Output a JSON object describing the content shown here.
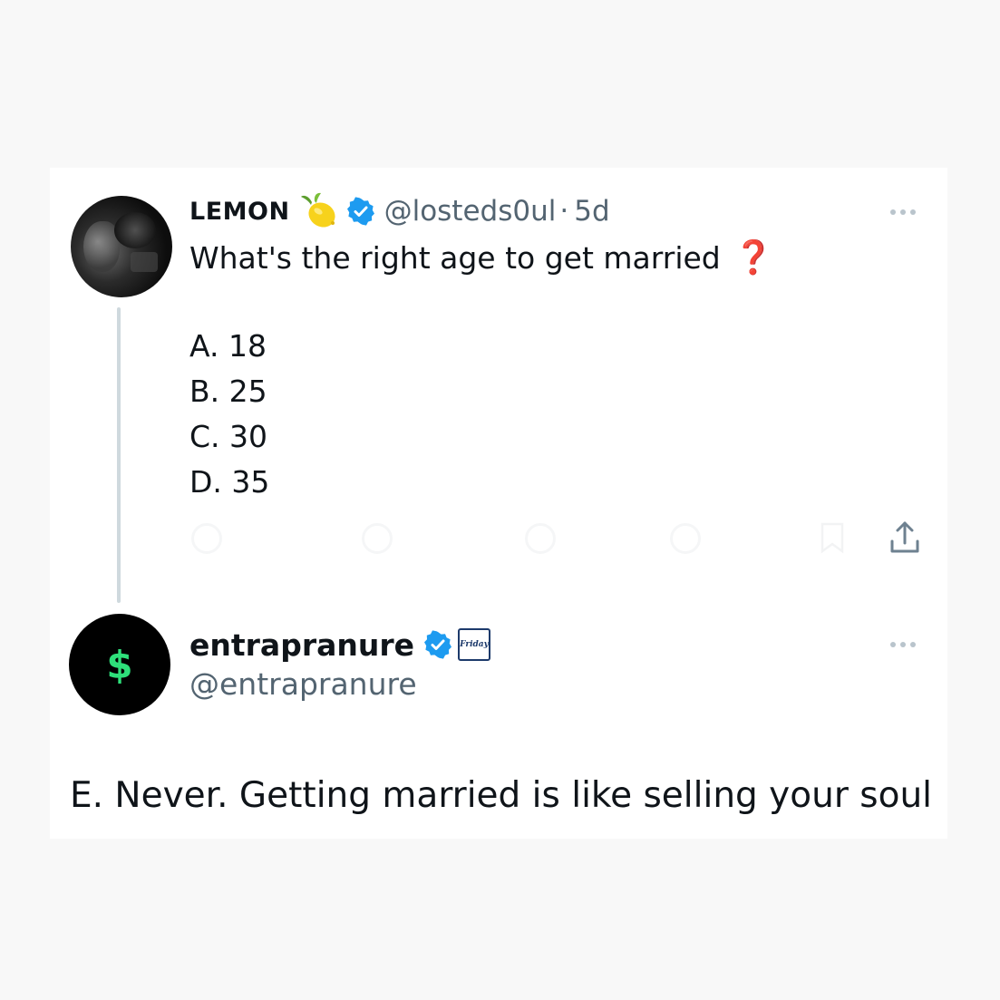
{
  "original_tweet": {
    "display_name": "LEMON",
    "name_emoji": "lemon-emoji",
    "verified": true,
    "handle": "@losteds0ul",
    "separator": "·",
    "time": "5d",
    "text": "What's the right age to get married",
    "text_emoji": "❓",
    "options": [
      "A. 18",
      "B. 25",
      "C. 30",
      "D. 35"
    ],
    "actions": [
      "reply-icon",
      "retweet-icon",
      "like-icon",
      "views-icon",
      "bookmark-icon",
      "share-icon"
    ]
  },
  "reply_tweet": {
    "display_name": "entrapranure",
    "verified": true,
    "affiliate_badge": "Friday",
    "handle": "@entrapranure",
    "avatar_symbol": "$",
    "text": "E. Never. Getting married is like selling your soul"
  },
  "colors": {
    "verified_blue": "#1d9bf0",
    "secondary_text": "#536471",
    "primary_text": "#0f1419",
    "dollar_green": "#2ee07a",
    "question_red": "#d81f26",
    "thread_line": "#cfd9de"
  }
}
